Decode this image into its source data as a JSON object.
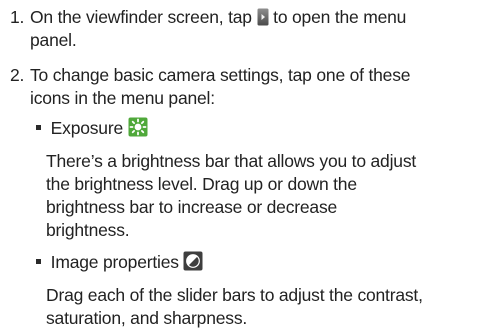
{
  "step1": {
    "number": "1.",
    "line1_before": "On the viewfinder screen, tap",
    "line1_after": "to open the menu",
    "line2": "panel.",
    "icon": "menu-panel-handle-icon"
  },
  "step2": {
    "number": "2.",
    "line1": "To change basic camera settings, tap one of these",
    "line2": "icons in the menu panel:",
    "items": [
      {
        "label": "Exposure",
        "icon": "exposure-icon",
        "desc": [
          "There’s a brightness bar that allows you to adjust",
          "the brightness level. Drag up or down the",
          "brightness bar to increase or decrease",
          "brightness."
        ]
      },
      {
        "label": "Image properties",
        "icon": "image-properties-icon",
        "desc": [
          "Drag each of the slider bars to adjust the contrast,",
          "saturation, and sharpness."
        ]
      }
    ]
  },
  "colors": {
    "text": "#222222",
    "exposure_icon_bg": "#4fa83a",
    "image_icon_bg": "#3e3e3e"
  }
}
